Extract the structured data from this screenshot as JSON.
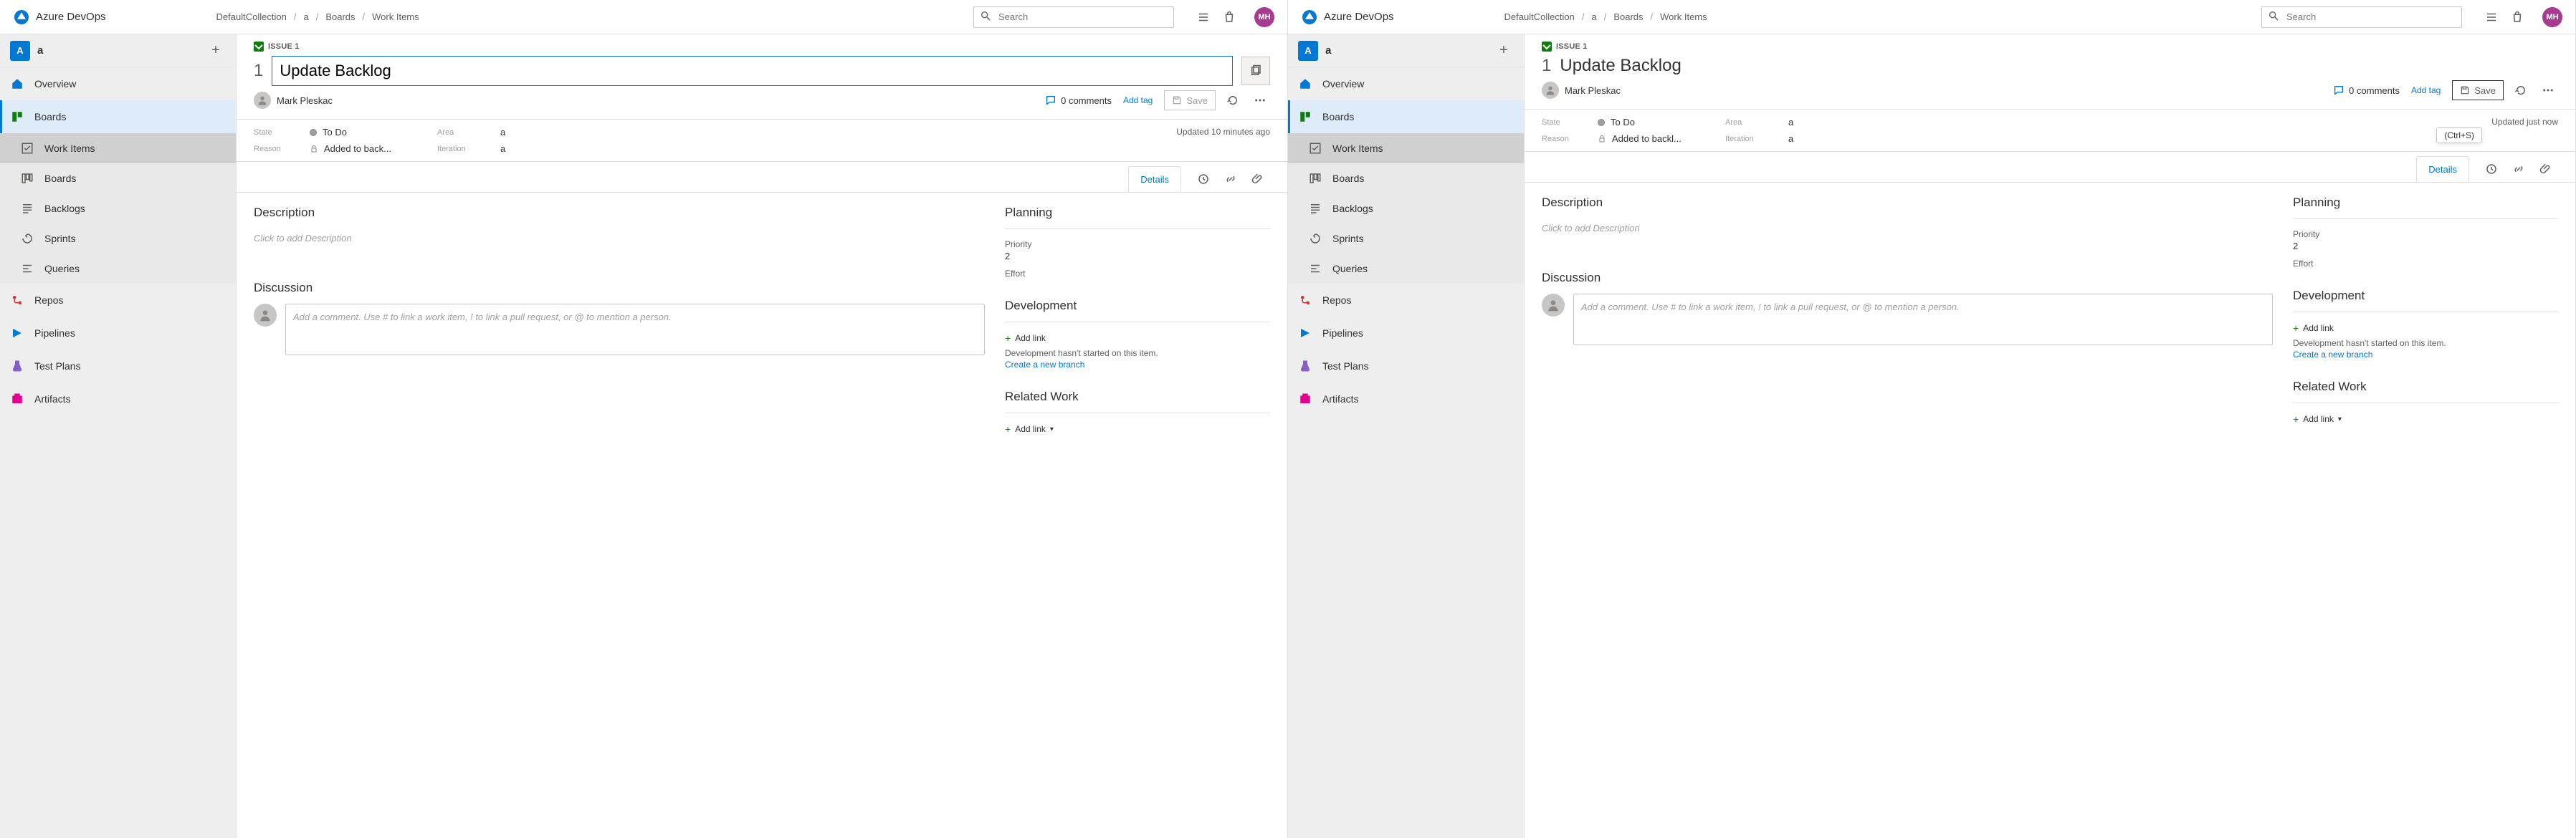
{
  "app": {
    "name": "Azure DevOps"
  },
  "breadcrumbs": [
    "DefaultCollection",
    "a",
    "Boards",
    "Work Items"
  ],
  "search": {
    "placeholder": "Search"
  },
  "avatar": "MH",
  "project": {
    "badge": "A",
    "name": "a"
  },
  "nav": [
    {
      "label": "Overview",
      "icon": "home"
    },
    {
      "label": "Boards",
      "icon": "board",
      "active": true,
      "children": [
        {
          "label": "Work Items",
          "active": true
        },
        {
          "label": "Boards"
        },
        {
          "label": "Backlogs"
        },
        {
          "label": "Sprints"
        },
        {
          "label": "Queries"
        }
      ]
    },
    {
      "label": "Repos",
      "icon": "repo"
    },
    {
      "label": "Pipelines",
      "icon": "pipe"
    },
    {
      "label": "Test Plans",
      "icon": "test"
    },
    {
      "label": "Artifacts",
      "icon": "art"
    }
  ],
  "left_pane": {
    "issue_tag": "ISSUE 1",
    "id": "1",
    "title": "Update Backlog",
    "assignee": "Mark Pleskac",
    "comments_count": "0 comments",
    "add_tag": "Add tag",
    "save": "Save",
    "state_label": "State",
    "state": "To Do",
    "area_label": "Area",
    "area": "a",
    "reason_label": "Reason",
    "reason": "Added to back...",
    "iteration_label": "Iteration",
    "iteration": "a",
    "updated": "Updated 10 minutes ago",
    "details_tab": "Details",
    "desc_h": "Description",
    "desc_ph": "Click to add Description",
    "discussion_h": "Discussion",
    "comment_ph": "Add a comment. Use # to link a work item, ! to link a pull request, or @ to mention a person.",
    "planning_h": "Planning",
    "priority_l": "Priority",
    "priority_v": "2",
    "effort_l": "Effort",
    "dev_h": "Development",
    "add_link": "Add link",
    "dev_note": "Development hasn't started on this item.",
    "branch": "Create a new branch",
    "related_h": "Related Work",
    "add_link2": "Add link"
  },
  "right_pane": {
    "issue_tag": "ISSUE 1",
    "id": "1",
    "title": "Update Backlog",
    "assignee": "Mark Pleskac",
    "comments_count": "0 comments",
    "add_tag": "Add tag",
    "save": "Save",
    "save_tooltip": "(Ctrl+S)",
    "state_label": "State",
    "state": "To Do",
    "area_label": "Area",
    "area": "a",
    "reason_label": "Reason",
    "reason": "Added to backl...",
    "iteration_label": "Iteration",
    "iteration": "a",
    "updated": "Updated just now",
    "details_tab": "Details",
    "desc_h": "Description",
    "desc_ph": "Click to add Description",
    "discussion_h": "Discussion",
    "comment_ph": "Add a comment. Use # to link a work item, ! to link a pull request, or @ to mention a person.",
    "planning_h": "Planning",
    "priority_l": "Priority",
    "priority_v": "2",
    "effort_l": "Effort",
    "dev_h": "Development",
    "add_link": "Add link",
    "dev_note": "Development hasn't started on this item.",
    "branch": "Create a new branch",
    "related_h": "Related Work",
    "add_link2": "Add link"
  }
}
